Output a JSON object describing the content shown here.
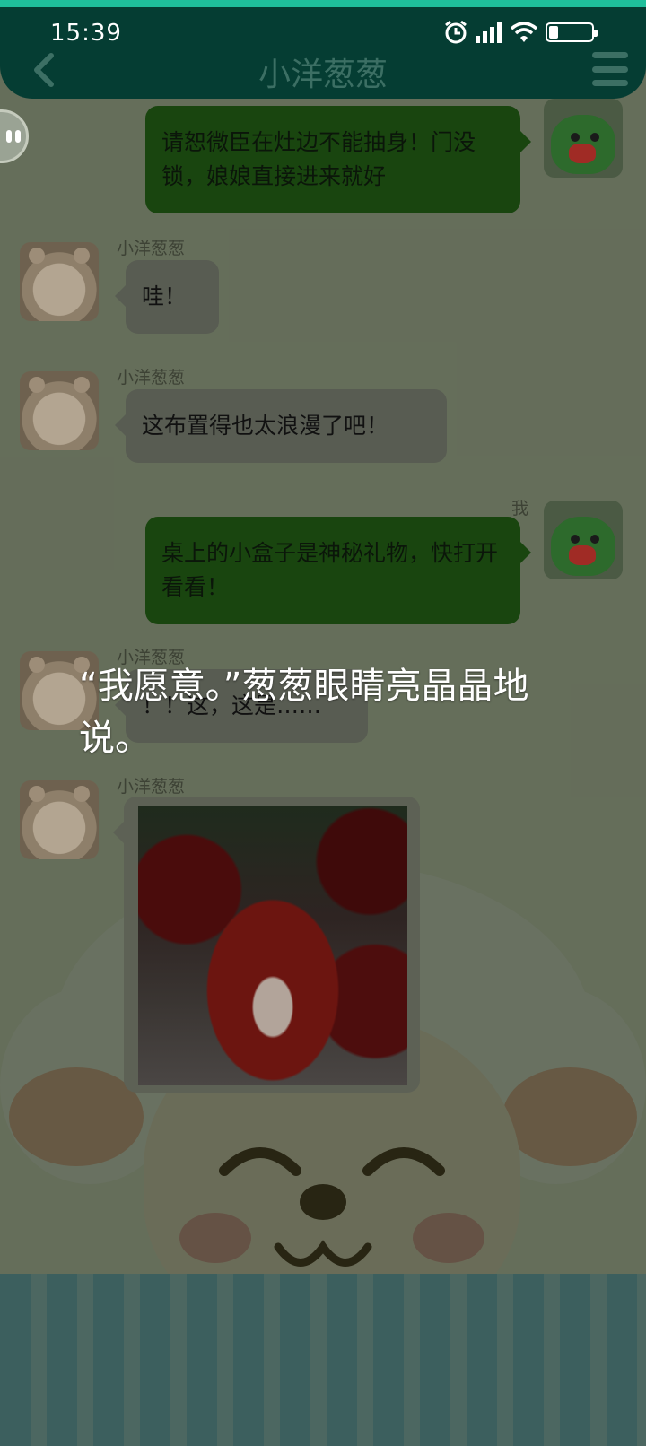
{
  "status_bar": {
    "time": "15:39"
  },
  "header": {
    "title": "小洋葱葱"
  },
  "messages": [
    {
      "side": "right",
      "sender": "",
      "text": "请恕微臣在灶边不能抽身！门没锁，娘娘直接进来就好"
    },
    {
      "side": "left",
      "sender": "小洋葱葱",
      "text": "哇！"
    },
    {
      "side": "left",
      "sender": "小洋葱葱",
      "text": "这布置得也太浪漫了吧！"
    },
    {
      "side": "right",
      "sender": "我",
      "text": "桌上的小盒子是神秘礼物，快打开看看！"
    },
    {
      "side": "left",
      "sender": "小洋葱葱",
      "text": "！！这，这是……"
    },
    {
      "side": "left",
      "sender": "小洋葱葱",
      "text": ""
    }
  ],
  "narration": "“我愿意。”葱葱眼睛亮晶晶地说。"
}
